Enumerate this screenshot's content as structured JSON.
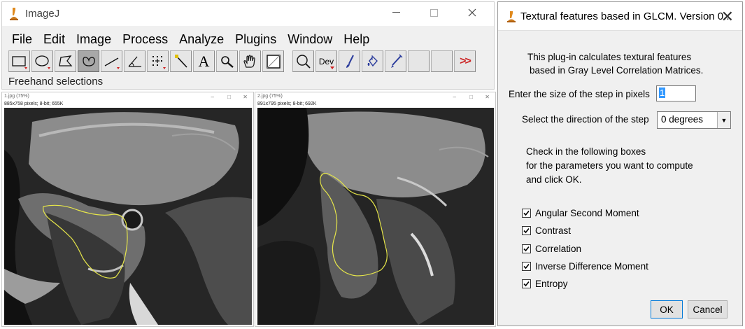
{
  "imagej": {
    "title": "ImageJ",
    "menu": [
      "File",
      "Edit",
      "Image",
      "Process",
      "Analyze",
      "Plugins",
      "Window",
      "Help"
    ],
    "tools": [
      {
        "icon": "rectangle-selection-icon",
        "interactable": true
      },
      {
        "icon": "oval-selection-icon",
        "interactable": true
      },
      {
        "icon": "polygon-selection-icon",
        "interactable": true
      },
      {
        "icon": "freehand-selection-icon",
        "interactable": true,
        "selected": true
      },
      {
        "icon": "line-selection-icon",
        "interactable": true
      },
      {
        "icon": "angle-tool-icon",
        "interactable": true
      },
      {
        "icon": "point-tool-icon",
        "interactable": true
      },
      {
        "icon": "wand-tool-icon",
        "interactable": true
      },
      {
        "icon": "text-tool-icon",
        "interactable": true
      },
      {
        "icon": "zoom-tool-icon",
        "interactable": true
      },
      {
        "icon": "hand-tool-icon",
        "interactable": true
      },
      {
        "icon": "color-picker-icon",
        "interactable": true
      },
      {
        "icon": "magnifier-icon",
        "interactable": true
      },
      {
        "icon": "developer-menu-icon",
        "label": "Dev",
        "interactable": true
      },
      {
        "icon": "brush-tool-icon",
        "interactable": true
      },
      {
        "icon": "flood-fill-icon",
        "interactable": true
      },
      {
        "icon": "pencil-tool-icon",
        "interactable": true
      },
      {
        "icon": "empty-tool-slot",
        "interactable": false
      },
      {
        "icon": "empty-tool-slot",
        "interactable": false
      },
      {
        "icon": "more-tools-icon",
        "label": ">>",
        "interactable": true
      }
    ],
    "text_tool_label": "A",
    "dev_label": "Dev",
    "more_label": ">>",
    "status": "Freehand selections"
  },
  "image_windows": [
    {
      "title": "1.jpg (75%)",
      "info": "885x758 pixels; 8-bit; 655K"
    },
    {
      "title": "2.jpg (75%)",
      "info": "891x795 pixels; 8-bit; 692K"
    }
  ],
  "dialog": {
    "title": "Textural features based in GLCM. Version 0...",
    "intro": [
      "This plug-in calculates textural features",
      "based in Gray Level Correlation Matrices."
    ],
    "step_label": "Enter the size of the step in pixels",
    "step_value": "1",
    "direction_label": "Select the direction of the step",
    "direction_value": "0 degrees",
    "instructions": [
      "Check in the following boxes",
      "for the parameters you want to compute",
      "and click OK."
    ],
    "parameters": [
      {
        "label": "Angular Second Moment",
        "checked": true
      },
      {
        "label": "Contrast",
        "checked": true
      },
      {
        "label": "Correlation",
        "checked": true
      },
      {
        "label": "Inverse Difference Moment",
        "checked": true
      },
      {
        "label": "Entropy",
        "checked": true
      }
    ],
    "ok_label": "OK",
    "cancel_label": "Cancel"
  },
  "colors": {
    "selection_outline": "#e6e64a",
    "dev_more_red": "#cc2222"
  }
}
